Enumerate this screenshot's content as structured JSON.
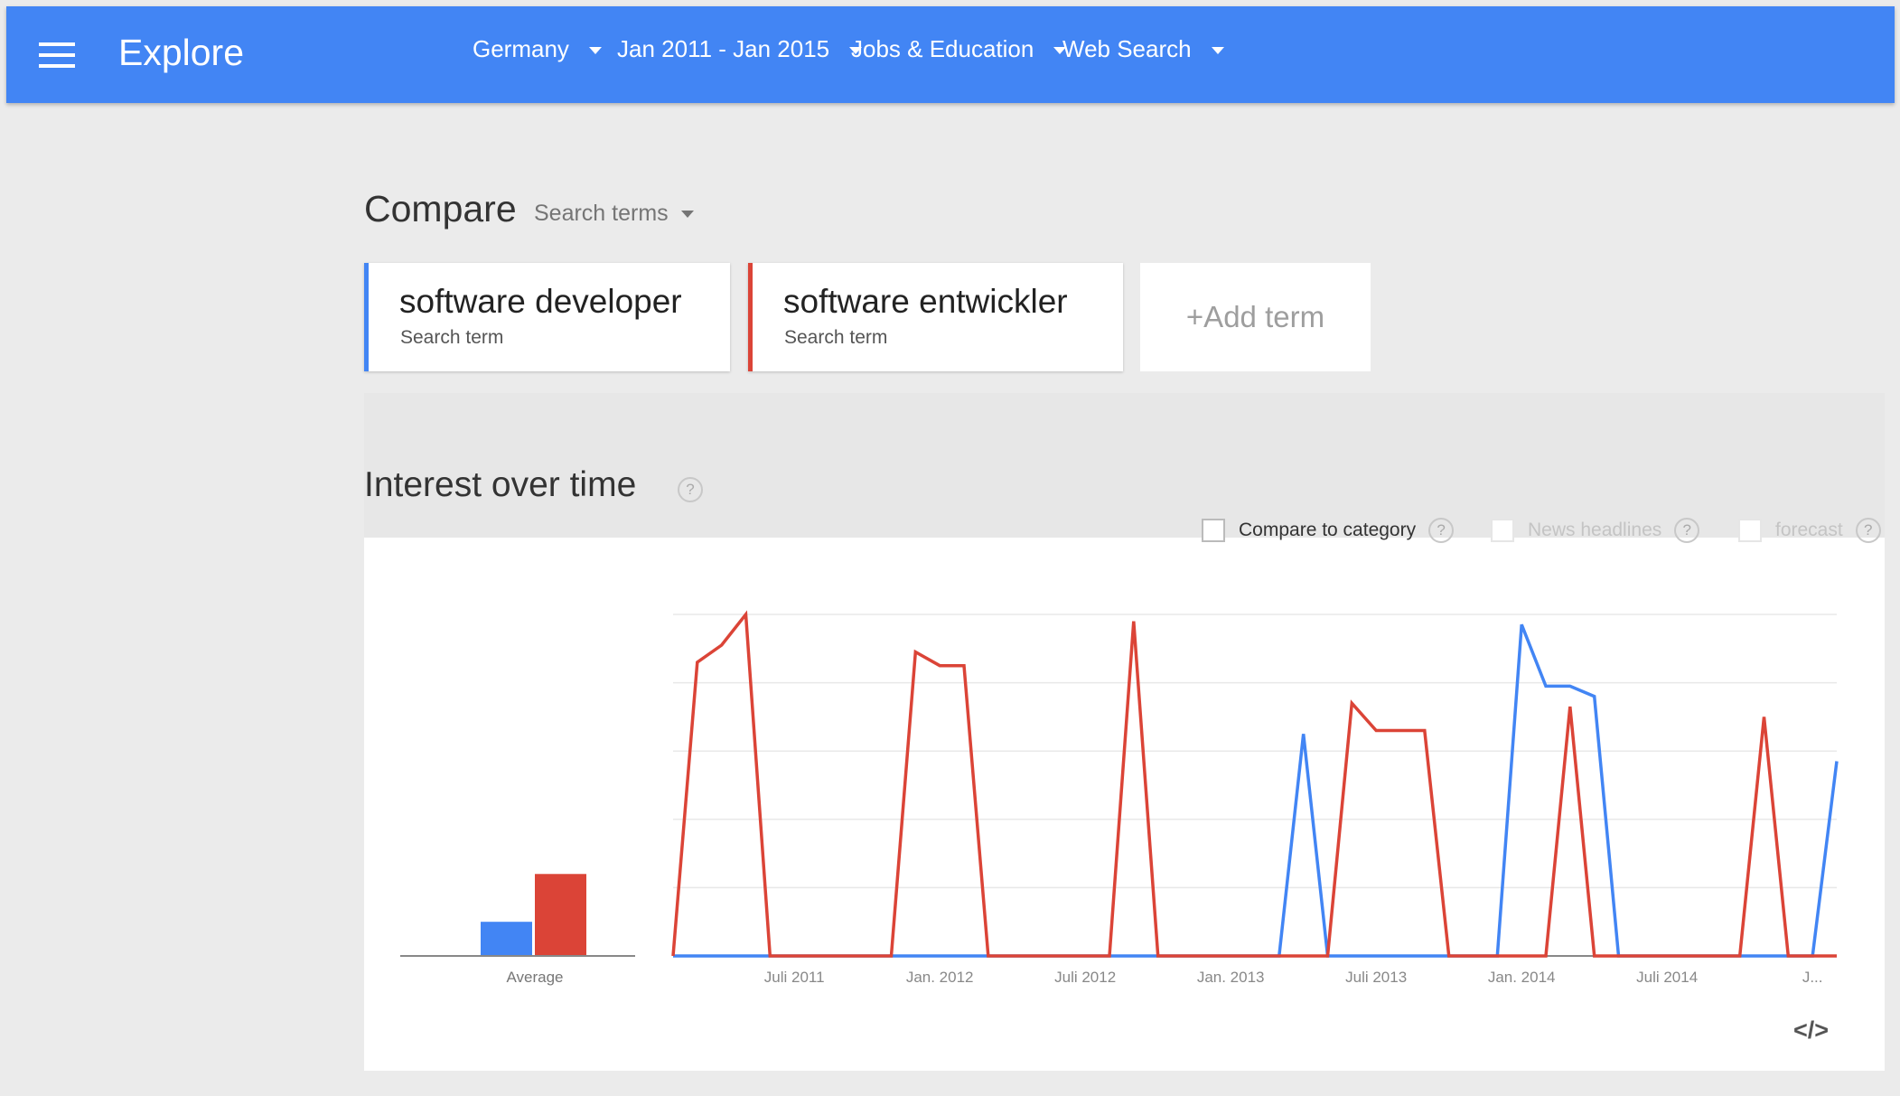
{
  "header": {
    "title": "Explore",
    "filters": [
      "Germany",
      "Jan 2011 - Jan 2015",
      "Jobs & Education",
      "Web Search"
    ]
  },
  "compare": {
    "title": "Compare",
    "mode": "Search terms",
    "terms": [
      {
        "name": "software developer",
        "type": "Search term",
        "color": "#4285f4"
      },
      {
        "name": "software entwickler",
        "type": "Search term",
        "color": "#db4437"
      }
    ],
    "add_label": "+Add term"
  },
  "interest": {
    "title": "Interest over time",
    "help": "?",
    "options": [
      {
        "label": "Compare to category",
        "enabled": true
      },
      {
        "label": "News headlines",
        "enabled": false
      },
      {
        "label": "forecast",
        "enabled": false
      }
    ],
    "embed": "</>"
  },
  "chart_data": [
    {
      "type": "bar",
      "categories": [
        "Average"
      ],
      "series": [
        {
          "name": "software developer",
          "values": [
            10
          ],
          "color": "#4285f4"
        },
        {
          "name": "software entwickler",
          "values": [
            24
          ],
          "color": "#db4437"
        }
      ],
      "ylim": [
        0,
        100
      ],
      "grid": false
    },
    {
      "type": "line",
      "x": [
        0,
        1,
        2,
        3,
        4,
        5,
        6,
        7,
        8,
        9,
        10,
        11,
        12,
        13,
        14,
        15,
        16,
        17,
        18,
        19,
        20,
        21,
        22,
        23,
        24,
        25,
        26,
        27,
        28,
        29,
        30,
        31,
        32,
        33,
        34,
        35,
        36,
        37,
        38,
        39,
        40,
        41,
        42,
        43,
        44,
        45,
        46,
        47,
        48
      ],
      "x_tick_labels": [
        "Juli 2011",
        "Jan. 2012",
        "Juli 2012",
        "Jan. 2013",
        "Juli 2013",
        "Jan. 2014",
        "Juli 2014",
        "J..."
      ],
      "x_tick_positions": [
        5,
        11,
        17,
        23,
        29,
        35,
        41,
        47
      ],
      "series": [
        {
          "name": "software developer",
          "color": "#4285f4",
          "values": [
            0,
            0,
            0,
            0,
            0,
            0,
            0,
            0,
            0,
            0,
            0,
            0,
            0,
            0,
            0,
            0,
            0,
            0,
            0,
            0,
            0,
            0,
            0,
            0,
            0,
            0,
            65,
            0,
            0,
            0,
            0,
            0,
            0,
            0,
            0,
            97,
            79,
            79,
            76,
            0,
            0,
            0,
            0,
            0,
            0,
            0,
            0,
            0,
            57
          ]
        },
        {
          "name": "software entwickler",
          "color": "#db4437",
          "values": [
            0,
            86,
            91,
            100,
            0,
            0,
            0,
            0,
            0,
            0,
            89,
            85,
            85,
            0,
            0,
            0,
            0,
            0,
            0,
            98,
            0,
            0,
            0,
            0,
            0,
            0,
            0,
            0,
            74,
            66,
            66,
            66,
            0,
            0,
            0,
            0,
            0,
            73,
            0,
            0,
            0,
            0,
            0,
            0,
            0,
            70,
            0,
            0,
            0
          ]
        }
      ],
      "ylim": [
        0,
        100
      ],
      "grid": true
    }
  ]
}
